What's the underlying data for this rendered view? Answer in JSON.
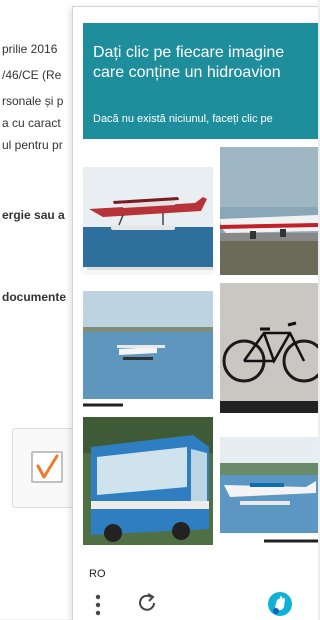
{
  "background": {
    "lines": [
      "prilie 2016",
      "/46/CE (Re",
      "rsonale și p",
      "a cu caract",
      "ul pentru pr",
      "ergie sau a",
      "documente"
    ]
  },
  "checkbox": {
    "checked": true
  },
  "challenge": {
    "title": "Dați clic pe fiecare imagine\ncare conține un hidroavion",
    "subtitle": "Dacă nu există niciunul, faceți clic pe",
    "accent_color": "#1f8e9c",
    "tiles": [
      {
        "subject": "seaplane on water"
      },
      {
        "subject": "airliner on runway"
      },
      {
        "subject": "seaplane on lake"
      },
      {
        "subject": "bicycle"
      },
      {
        "subject": "bus"
      },
      {
        "subject": "seaplane taking off"
      }
    ]
  },
  "footer": {
    "language": "RO",
    "menu_icon": "more-vertical-icon",
    "reload_icon": "reload-icon",
    "logo_icon": "hcaptcha-logo-icon"
  }
}
